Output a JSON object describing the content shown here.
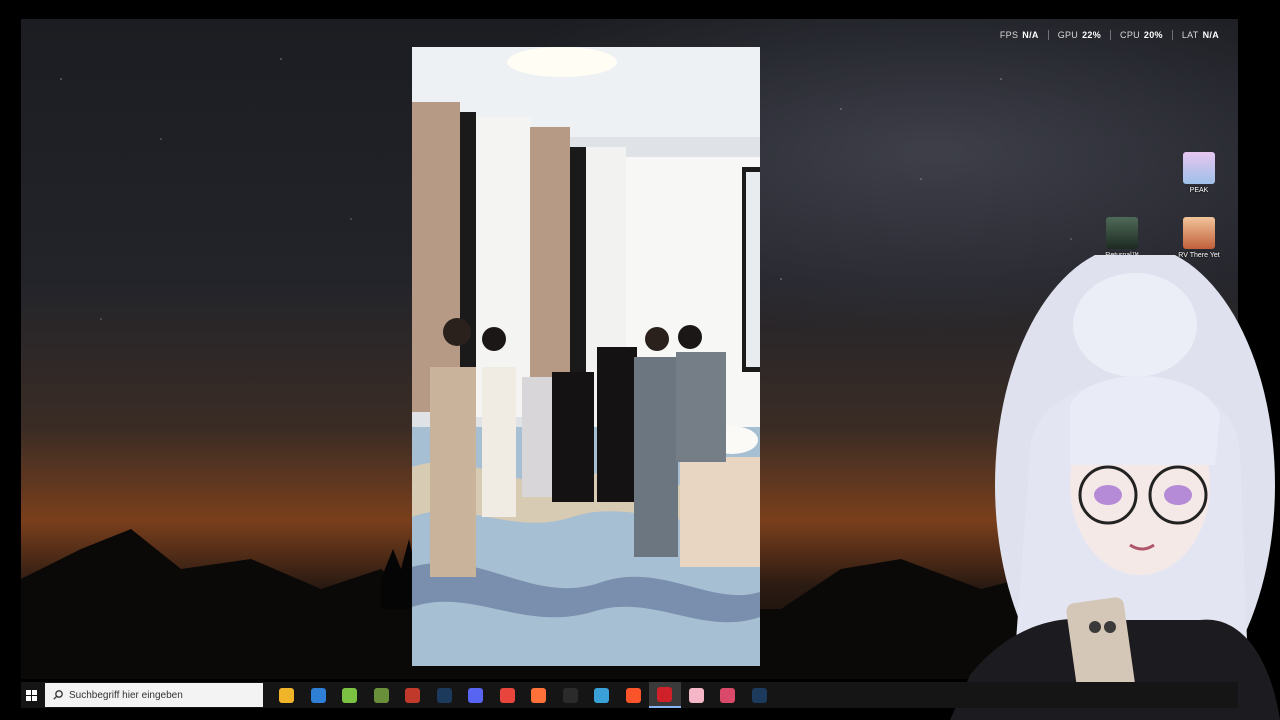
{
  "hud": {
    "fps_label": "FPS",
    "fps_value": "N/A",
    "gpu_label": "GPU",
    "gpu_value": "22%",
    "cpu_label": "CPU",
    "cpu_value": "20%",
    "lat_label": "LAT",
    "lat_value": "N/A"
  },
  "desktop_icons": [
    {
      "label": "PEAK",
      "icon": "peak-game-icon",
      "color": "#c89bd8"
    },
    {
      "label": "Returnal™",
      "icon": "returnal-game-icon",
      "color": "#3b4a3f"
    },
    {
      "label": "RV There Yet",
      "icon": "rv-there-yet-game-icon",
      "color": "#d98a4e"
    }
  ],
  "taskbar": {
    "search_placeholder": "Suchbegriff hier eingeben",
    "apps": [
      {
        "name": "file-explorer",
        "icon": "folder-icon",
        "color": "#f0b429",
        "glyph": ""
      },
      {
        "name": "microsoft-store",
        "icon": "store-icon",
        "color": "#2f7fd6",
        "glyph": ""
      },
      {
        "name": "android-app",
        "icon": "android-icon",
        "color": "#7cc242",
        "glyph": ""
      },
      {
        "name": "minecraft",
        "icon": "minecraft-icon",
        "color": "#6a8f3a",
        "glyph": ""
      },
      {
        "name": "streamer-bot",
        "icon": "streamer-app-icon",
        "color": "#c0392b",
        "glyph": ""
      },
      {
        "name": "steam",
        "icon": "steam-icon",
        "color": "#1b3a5c",
        "glyph": ""
      },
      {
        "name": "discord",
        "icon": "discord-icon",
        "color": "#5865f2",
        "glyph": ""
      },
      {
        "name": "chrome",
        "icon": "chrome-icon",
        "color": "#e8453c",
        "glyph": ""
      },
      {
        "name": "firefox",
        "icon": "firefox-icon",
        "color": "#ff7139",
        "glyph": ""
      },
      {
        "name": "speedtest",
        "icon": "gauge-icon",
        "color": "#2b2b2b",
        "glyph": ""
      },
      {
        "name": "zapper",
        "icon": "lightning-icon",
        "color": "#3aa0d8",
        "glyph": ""
      },
      {
        "name": "brave",
        "icon": "brave-lion-icon",
        "color": "#fb542b",
        "glyph": ""
      },
      {
        "name": "obs-recorder",
        "icon": "record-icon",
        "color": "#d0202a",
        "glyph": "",
        "active": true
      },
      {
        "name": "vtube-app",
        "icon": "heart-icon",
        "color": "#f5b6c8",
        "glyph": ""
      },
      {
        "name": "game-launcher",
        "icon": "launcher-icon",
        "color": "#d94a6a",
        "glyph": ""
      },
      {
        "name": "steam-2",
        "icon": "steam-icon",
        "color": "#1b3a5c",
        "glyph": ""
      }
    ]
  }
}
